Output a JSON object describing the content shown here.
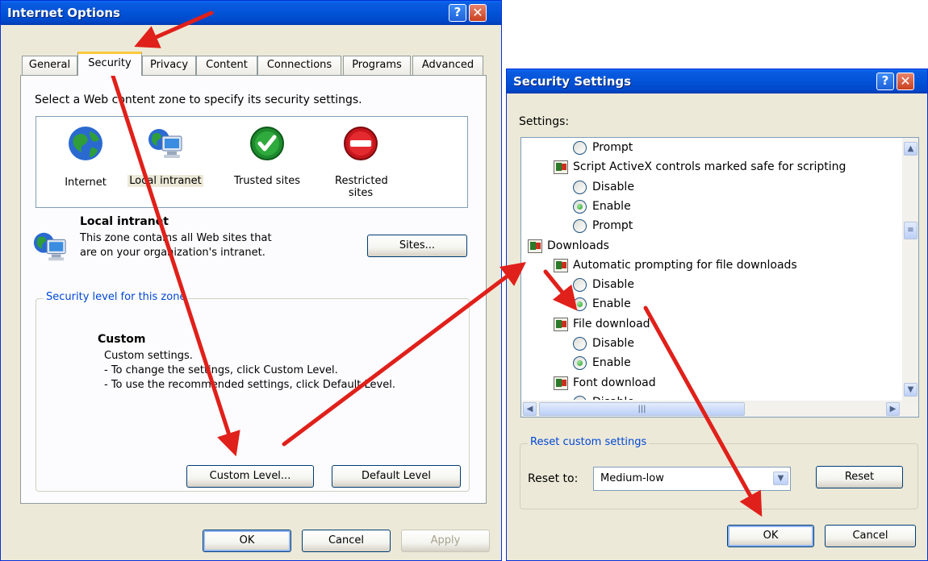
{
  "internet_options": {
    "title": "Internet Options",
    "tabs": [
      "General",
      "Security",
      "Privacy",
      "Content",
      "Connections",
      "Programs",
      "Advanced"
    ],
    "active_tab": "Security",
    "zone_prompt": "Select a Web content zone to specify its security settings.",
    "zones": [
      {
        "label": "Internet",
        "icon": "globe-icon"
      },
      {
        "label": "Local intranet",
        "icon": "network-computer-icon"
      },
      {
        "label": "Trusted sites",
        "icon": "checkmark-icon"
      },
      {
        "label": "Restricted sites",
        "icon": "no-entry-icon"
      }
    ],
    "selected_zone": {
      "name": "Local intranet",
      "description_line1": "This zone contains all Web sites that",
      "description_line2": "are on your organization's intranet.",
      "sites_button": "Sites..."
    },
    "security_level": {
      "group_label": "Security level for this zone",
      "level_name": "Custom",
      "line1": "Custom settings.",
      "line2": "- To change the settings, click Custom Level.",
      "line3": "- To use the recommended settings, click Default Level."
    },
    "custom_level_button": "Custom Level...",
    "default_level_button": "Default Level",
    "ok_button": "OK",
    "cancel_button": "Cancel",
    "apply_button": "Apply"
  },
  "security_settings": {
    "title": "Security Settings",
    "settings_label": "Settings:",
    "rows": [
      {
        "kind": "radio",
        "label": "Prompt",
        "checked": false
      },
      {
        "kind": "setting",
        "label": "Script ActiveX controls marked safe for scripting"
      },
      {
        "kind": "radio",
        "label": "Disable",
        "checked": false
      },
      {
        "kind": "radio",
        "label": "Enable",
        "checked": true
      },
      {
        "kind": "radio",
        "label": "Prompt",
        "checked": false
      },
      {
        "kind": "category",
        "label": "Downloads"
      },
      {
        "kind": "setting",
        "label": "Automatic prompting for file downloads"
      },
      {
        "kind": "radio",
        "label": "Disable",
        "checked": false
      },
      {
        "kind": "radio",
        "label": "Enable",
        "checked": true
      },
      {
        "kind": "setting",
        "label": "File download"
      },
      {
        "kind": "radio",
        "label": "Disable",
        "checked": false
      },
      {
        "kind": "radio",
        "label": "Enable",
        "checked": true
      },
      {
        "kind": "setting",
        "label": "Font download"
      },
      {
        "kind": "radio",
        "label": "Disable",
        "checked": false
      }
    ],
    "reset_group_label": "Reset custom settings",
    "reset_to_label": "Reset to:",
    "reset_to_value": "Medium-low",
    "reset_button": "Reset",
    "ok_button": "OK",
    "cancel_button": "Cancel"
  },
  "annotations": {
    "arrow_color": "#e0201a"
  }
}
